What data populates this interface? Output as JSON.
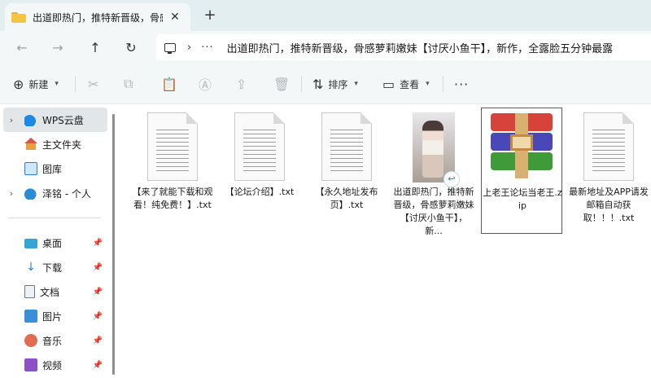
{
  "tab": {
    "title": "出道即热门，推特新晋级，骨感",
    "close": "✕",
    "new": "+"
  },
  "nav": {
    "back": "←",
    "forward": "→",
    "up": "↑",
    "refresh": "↻"
  },
  "address": {
    "sep": "›",
    "more": "···",
    "path": "出道即热门，推特新晋级，骨感萝莉嫩妹【讨厌小鱼干】，新作，全露脸五分钟最露"
  },
  "toolbar": {
    "new_label": "新建",
    "new_icon": "plus-circle-icon",
    "sort_label": "排序",
    "view_label": "查看",
    "more": "···"
  },
  "sidebar": {
    "items": [
      {
        "label": "WPS云盘",
        "icon": "cloud-icon",
        "chevron": "›"
      },
      {
        "label": "主文件夹",
        "icon": "home-icon"
      },
      {
        "label": "图库",
        "icon": "gallery-icon"
      },
      {
        "label": "泽铭 - 个人",
        "icon": "onedrive-icon",
        "chevron": "›"
      }
    ],
    "quick": [
      {
        "label": "桌面",
        "icon": "desktop-icon"
      },
      {
        "label": "下载",
        "icon": "download-icon"
      },
      {
        "label": "文档",
        "icon": "documents-icon"
      },
      {
        "label": "图片",
        "icon": "pictures-icon"
      },
      {
        "label": "音乐",
        "icon": "music-icon"
      },
      {
        "label": "视频",
        "icon": "video-icon"
      }
    ]
  },
  "files": [
    {
      "name": "【来了就能下载和观看！纯免费！】.txt",
      "type": "txt"
    },
    {
      "name": "【论坛介绍】.txt",
      "type": "txt"
    },
    {
      "name": "【永久地址发布页】.txt",
      "type": "txt"
    },
    {
      "name": "出道即热门，推特新晋级，骨感萝莉嫩妹【讨厌小鱼干】，新...",
      "type": "video"
    },
    {
      "name": "上老王论坛当老王.zip",
      "type": "zip"
    },
    {
      "name": "最新地址及APP请发邮箱自动获取！！！.txt",
      "type": "txt"
    }
  ]
}
